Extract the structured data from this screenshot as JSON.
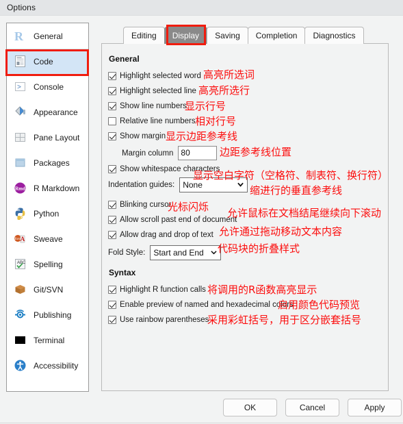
{
  "window": {
    "title": "Options"
  },
  "sidebar": {
    "items": [
      {
        "label": "General",
        "icon": "r-logo-icon",
        "selected": false
      },
      {
        "label": "Code",
        "icon": "document-code-icon",
        "selected": true
      },
      {
        "label": "Console",
        "icon": "prompt-icon",
        "selected": false
      },
      {
        "label": "Appearance",
        "icon": "paint-bucket-icon",
        "selected": false
      },
      {
        "label": "Pane Layout",
        "icon": "grid-panes-icon",
        "selected": false
      },
      {
        "label": "Packages",
        "icon": "box-icon",
        "selected": false
      },
      {
        "label": "R Markdown",
        "icon": "rmd-circle-icon",
        "selected": false
      },
      {
        "label": "Python",
        "icon": "python-icon",
        "selected": false
      },
      {
        "label": "Sweave",
        "icon": "sweave-pdf-icon",
        "selected": false
      },
      {
        "label": "Spelling",
        "icon": "abc-check-icon",
        "selected": false
      },
      {
        "label": "Git/SVN",
        "icon": "package-box-icon",
        "selected": false
      },
      {
        "label": "Publishing",
        "icon": "publish-icon",
        "selected": false
      },
      {
        "label": "Terminal",
        "icon": "terminal-icon",
        "selected": false
      },
      {
        "label": "Accessibility",
        "icon": "accessibility-icon",
        "selected": false
      }
    ]
  },
  "tabs": [
    {
      "label": "Editing",
      "active": false
    },
    {
      "label": "Display",
      "active": true
    },
    {
      "label": "Saving",
      "active": false
    },
    {
      "label": "Completion",
      "active": false
    },
    {
      "label": "Diagnostics",
      "active": false
    }
  ],
  "sections": {
    "general_heading": "General",
    "syntax_heading": "Syntax"
  },
  "options": {
    "highlight_selected_word": {
      "label": "Highlight selected word",
      "checked": true
    },
    "highlight_selected_line": {
      "label": "Highlight selected line",
      "checked": true
    },
    "show_line_numbers": {
      "label": "Show line numbers",
      "checked": true
    },
    "relative_line_numbers": {
      "label": "Relative line numbers",
      "checked": false
    },
    "show_margin": {
      "label": "Show margin",
      "checked": true
    },
    "margin_column": {
      "label": "Margin column",
      "value": "80"
    },
    "show_whitespace": {
      "label": "Show whitespace characters",
      "checked": true
    },
    "indentation_guides": {
      "label": "Indentation guides:",
      "value": "None"
    },
    "blinking_cursor": {
      "label": "Blinking cursor",
      "checked": true
    },
    "allow_scroll_past_end": {
      "label": "Allow scroll past end of document",
      "checked": true
    },
    "allow_drag_drop": {
      "label": "Allow drag and drop of text",
      "checked": true
    },
    "fold_style": {
      "label": "Fold Style:",
      "value": "Start and End"
    },
    "highlight_r_calls": {
      "label": "Highlight R function calls",
      "checked": true
    },
    "enable_color_preview": {
      "label": "Enable preview of named and hexadecimal colors",
      "checked": true
    },
    "rainbow_parentheses": {
      "label": "Use rainbow parentheses",
      "checked": true
    }
  },
  "annotations": {
    "highlight_selected_word": "高亮所选词",
    "highlight_selected_line": "高亮所选行",
    "show_line_numbers": "显示行号",
    "relative_line_numbers": "相对行号",
    "show_margin": "显示边距参考线",
    "margin_column": "边距参考线位置",
    "show_whitespace": "显示空白字符（空格符、制表符、换行符）",
    "indentation_guides": "缩进行的垂直参考线",
    "blinking_cursor": "光标闪烁",
    "allow_scroll_past_end": "允许鼠标在文档结尾继续向下滚动",
    "allow_drag_drop": "允许通过拖动移动文本内容",
    "fold_style": "代码块的折叠样式",
    "highlight_r_calls": "将调用的R函数高亮显示",
    "enable_color_preview": "启用颜色代码预览",
    "rainbow_parentheses": "采用彩虹括号，用于区分嵌套括号"
  },
  "footer": {
    "ok": "OK",
    "cancel": "Cancel",
    "apply": "Apply"
  },
  "colors": {
    "annotation_red": "#fc0d0d",
    "selection_blue": "#d3e5f6",
    "active_tab_gray": "#8a8a8a"
  }
}
